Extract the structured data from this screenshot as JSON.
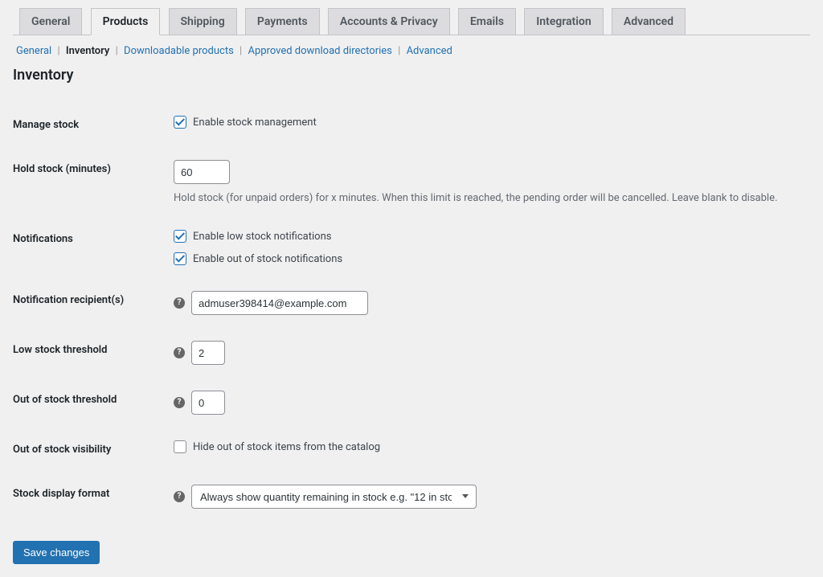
{
  "tabs": {
    "general": "General",
    "products": "Products",
    "shipping": "Shipping",
    "payments": "Payments",
    "accounts": "Accounts & Privacy",
    "emails": "Emails",
    "integration": "Integration",
    "advanced": "Advanced"
  },
  "subnav": {
    "general": "General",
    "inventory": "Inventory",
    "downloadable": "Downloadable products",
    "approved": "Approved download directories",
    "advanced": "Advanced"
  },
  "heading": "Inventory",
  "fields": {
    "manage_stock": {
      "label": "Manage stock",
      "checkbox_label": "Enable stock management"
    },
    "hold_stock": {
      "label": "Hold stock (minutes)",
      "value": "60",
      "description": "Hold stock (for unpaid orders) for x minutes. When this limit is reached, the pending order will be cancelled. Leave blank to disable."
    },
    "notifications": {
      "label": "Notifications",
      "low_stock_label": "Enable low stock notifications",
      "out_of_stock_label": "Enable out of stock notifications"
    },
    "recipient": {
      "label": "Notification recipient(s)",
      "value": "admuser398414@example.com"
    },
    "low_threshold": {
      "label": "Low stock threshold",
      "value": "2"
    },
    "out_threshold": {
      "label": "Out of stock threshold",
      "value": "0"
    },
    "visibility": {
      "label": "Out of stock visibility",
      "checkbox_label": "Hide out of stock items from the catalog"
    },
    "display_format": {
      "label": "Stock display format",
      "selected": "Always show quantity remaining in stock e.g. \"12 in sto…"
    }
  },
  "help_glyph": "?",
  "save_button": "Save changes"
}
